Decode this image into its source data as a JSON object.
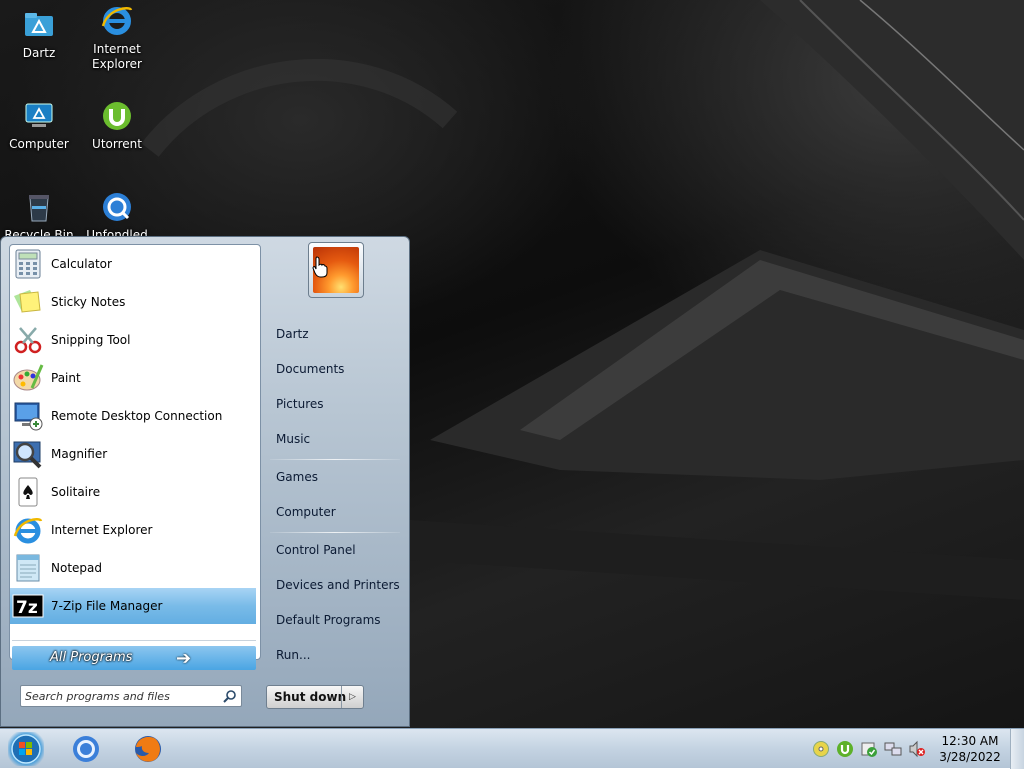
{
  "desktop": {
    "icons": [
      {
        "label": "Dartz",
        "icon": "dartz-folder-icon"
      },
      {
        "label": "Internet\nExplorer",
        "icon": "internet-explorer-icon"
      },
      {
        "label": "Computer",
        "icon": "computer-icon"
      },
      {
        "label": "Utorrent",
        "icon": "utorrent-icon"
      },
      {
        "label": "Recycle Bin",
        "icon": "recycle-bin-icon"
      },
      {
        "label": "Unfondled",
        "icon": "unfondled-icon"
      }
    ]
  },
  "start_menu": {
    "programs": [
      {
        "label": "Calculator",
        "icon": "calculator-icon"
      },
      {
        "label": "Sticky Notes",
        "icon": "sticky-notes-icon"
      },
      {
        "label": "Snipping Tool",
        "icon": "snipping-tool-icon"
      },
      {
        "label": "Paint",
        "icon": "paint-icon"
      },
      {
        "label": "Remote Desktop Connection",
        "icon": "remote-desktop-icon"
      },
      {
        "label": "Magnifier",
        "icon": "magnifier-icon"
      },
      {
        "label": "Solitaire",
        "icon": "solitaire-icon"
      },
      {
        "label": "Internet Explorer",
        "icon": "internet-explorer-icon"
      },
      {
        "label": "Notepad",
        "icon": "notepad-icon"
      },
      {
        "label": "7-Zip File Manager",
        "icon": "7zip-icon",
        "selected": true
      }
    ],
    "all_programs_label": "All Programs",
    "search_placeholder": "Search programs and files",
    "right_links": [
      {
        "label": "Dartz"
      },
      {
        "label": "Documents"
      },
      {
        "label": "Pictures"
      },
      {
        "label": "Music"
      },
      {
        "label": "Games"
      },
      {
        "label": "Computer"
      },
      {
        "label": "Control Panel"
      },
      {
        "label": "Devices and Printers"
      },
      {
        "label": "Default Programs"
      },
      {
        "label": "Run..."
      }
    ],
    "shutdown_label": "Shut down",
    "shutdown_arrow": "▷"
  },
  "taskbar": {
    "pinned": [
      {
        "icon": "chrome-icon"
      },
      {
        "icon": "firefox-icon"
      }
    ],
    "tray_icons": [
      "cd-drive-icon",
      "utorrent-tray-icon",
      "action-center-icon",
      "network-icon",
      "volume-muted-icon"
    ],
    "clock_time": "12:30 AM",
    "clock_date": "3/28/2022"
  },
  "colors": {
    "selection": "#63aee2",
    "taskbar": "#c4d3e2",
    "desktop": "#111111"
  }
}
